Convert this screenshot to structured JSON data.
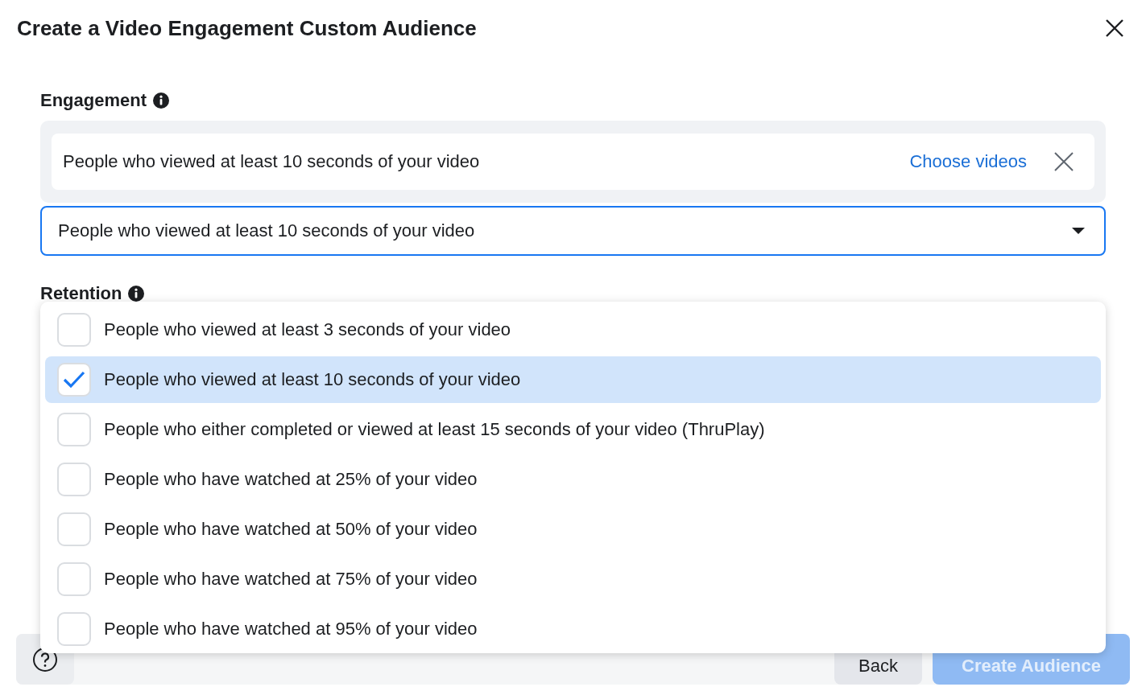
{
  "dialog": {
    "title": "Create a Video Engagement Custom Audience"
  },
  "engagement": {
    "label": "Engagement",
    "rule_card": {
      "text": "People who viewed at least 10 seconds of your video",
      "link": "Choose videos"
    },
    "select": {
      "value": "People who viewed at least 10 seconds of your video",
      "expanded": true
    }
  },
  "retention": {
    "label": "Retention"
  },
  "menu": {
    "options": [
      {
        "label": "People who viewed at least 3 seconds of your video",
        "checked": false,
        "selected": false
      },
      {
        "label": "People who viewed at least 10 seconds of your video",
        "checked": true,
        "selected": true
      },
      {
        "label": "People who either completed or viewed at least 15 seconds of your video (ThruPlay)",
        "checked": false,
        "selected": false
      },
      {
        "label": "People who have watched at 25% of your video",
        "checked": false,
        "selected": false
      },
      {
        "label": "People who have watched at 50% of your video",
        "checked": false,
        "selected": false
      },
      {
        "label": "People who have watched at 75% of your video",
        "checked": false,
        "selected": false
      },
      {
        "label": "People who have watched at 95% of your video",
        "checked": false,
        "selected": false
      }
    ]
  },
  "footer": {
    "buttons": [
      {
        "kind": "secondary",
        "label": "Back",
        "disabled": false
      },
      {
        "kind": "primary",
        "label": "Create Audience",
        "disabled": true
      }
    ]
  }
}
